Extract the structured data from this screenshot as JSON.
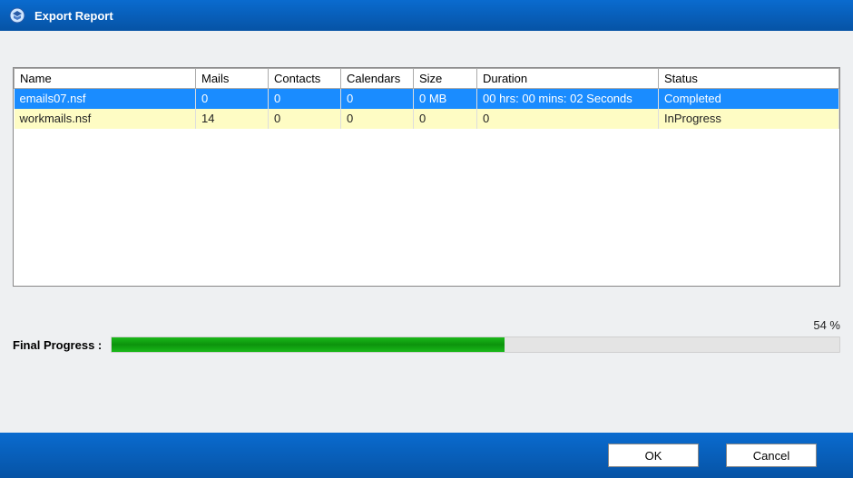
{
  "window": {
    "title": "Export Report"
  },
  "table": {
    "headers": {
      "name": "Name",
      "mails": "Mails",
      "contacts": "Contacts",
      "calendars": "Calendars",
      "size": "Size",
      "duration": "Duration",
      "status": "Status"
    },
    "rows": [
      {
        "name": "emails07.nsf",
        "mails": "0",
        "contacts": "0",
        "calendars": "0",
        "size": "0 MB",
        "duration": "00 hrs: 00 mins: 02 Seconds",
        "status": "Completed"
      },
      {
        "name": "workmails.nsf",
        "mails": "14",
        "contacts": "0",
        "calendars": "0",
        "size": "0",
        "duration": "0",
        "status": "InProgress"
      }
    ]
  },
  "progress": {
    "label": "Final Progress :",
    "percent_text": "54 %",
    "percent_value": 54
  },
  "footer": {
    "ok": "OK",
    "cancel": "Cancel"
  }
}
